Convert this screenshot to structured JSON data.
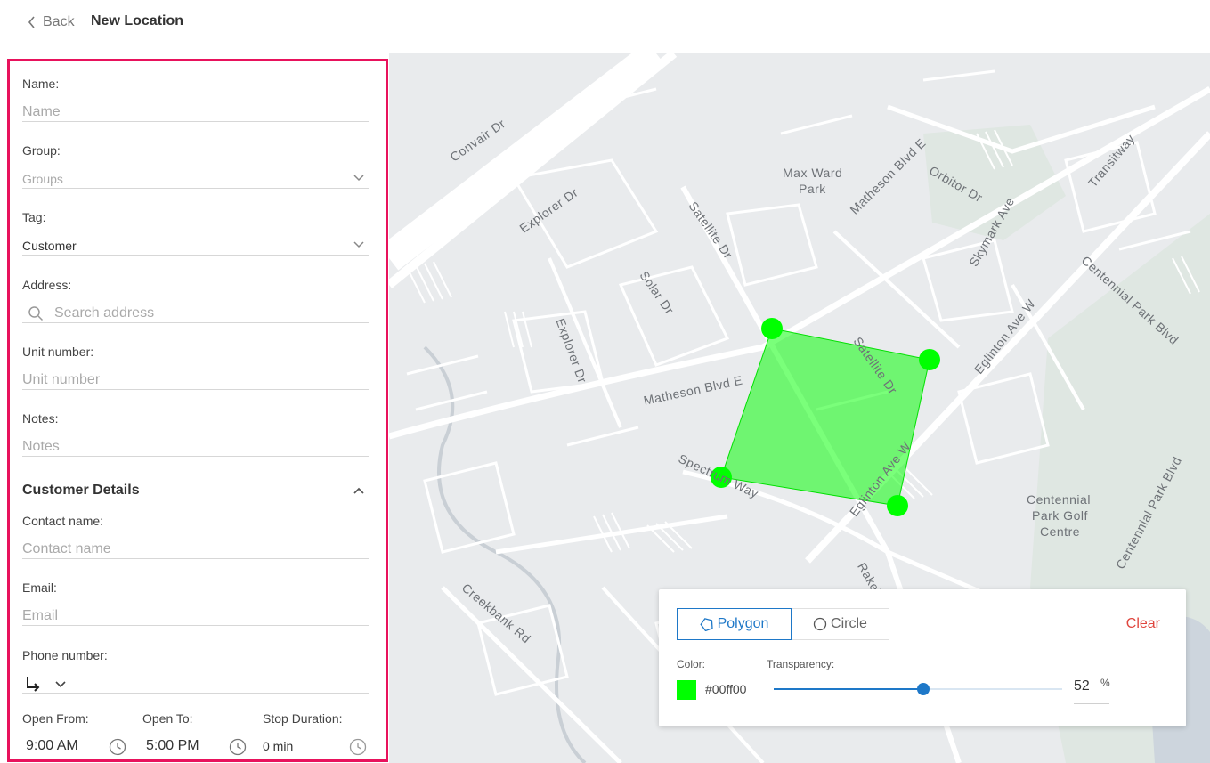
{
  "header": {
    "back_label": "Back",
    "title": "New Location"
  },
  "form": {
    "name": {
      "label": "Name:",
      "placeholder": "Name"
    },
    "group": {
      "label": "Group:",
      "placeholder": "Groups"
    },
    "tag": {
      "label": "Tag:",
      "value": "Customer"
    },
    "address": {
      "label": "Address:",
      "placeholder": "Search address"
    },
    "unit": {
      "label": "Unit number:",
      "placeholder": "Unit number"
    },
    "notes": {
      "label": "Notes:",
      "placeholder": "Notes"
    },
    "customer_details": {
      "title": "Customer Details",
      "expanded": true
    },
    "contact": {
      "label": "Contact name:",
      "placeholder": "Contact name"
    },
    "email": {
      "label": "Email:",
      "placeholder": "Email"
    },
    "phone": {
      "label": "Phone number:",
      "icon": "arrow-turn-icon"
    },
    "open_from": {
      "label": "Open From:",
      "value": "9:00 AM"
    },
    "open_to": {
      "label": "Open To:",
      "value": "5:00 PM"
    },
    "stop_duration": {
      "label": "Stop Duration:",
      "value": "0 min"
    }
  },
  "map": {
    "labels": {
      "convair": "Convair Dr",
      "explorer1": "Explorer Dr",
      "explorer2": "Explorer Dr",
      "satellite1": "Satellite Dr",
      "satellite2": "Satellite Dr",
      "solar": "Solar Dr",
      "max_ward_1": "Max Ward",
      "max_ward_2": "Park",
      "matheson_e": "Matheson Blvd E",
      "matheson_e2": "Matheson Blvd E",
      "orbitor": "Orbitor Dr",
      "skymark": "Skymark Ave",
      "transitway": "Transitway",
      "centennial_blvd": "Centennial Park Blvd",
      "centennial_blvd2": "Centennial Park Blvd",
      "eglinton1": "Eglinton Ave W",
      "eglinton2": "Eglinton Ave W",
      "spectrum": "Spectrum Way",
      "golf1": "Centennial",
      "golf2": "Park Golf",
      "golf3": "Centre",
      "creekbank": "Creekbank Rd",
      "rakely": "Rakely"
    }
  },
  "tools": {
    "polygon_label": "Polygon",
    "circle_label": "Circle",
    "active_tool": "polygon",
    "clear_label": "Clear",
    "color_label": "Color:",
    "color_value": "#00ff00",
    "color_hex_text": "#00ff00",
    "transparency_label": "Transparency:",
    "transparency_value": "52",
    "transparency_unit": "%",
    "transparency_fraction": 0.52
  },
  "colors": {
    "accent": "#1e78c8",
    "panel_border": "#e8125c",
    "clear": "#e0463e",
    "polygon_fill": "#00ff00"
  }
}
